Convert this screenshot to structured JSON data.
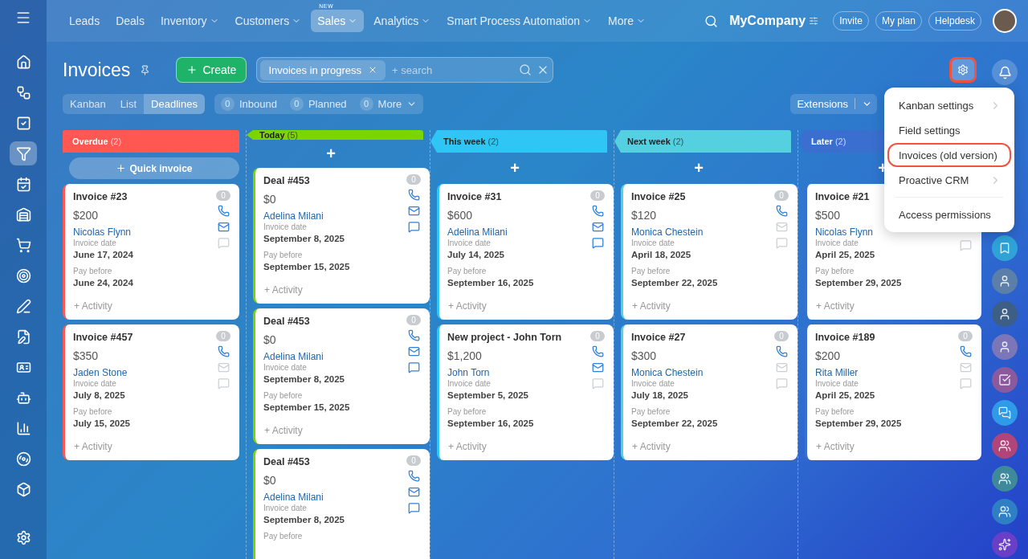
{
  "sidebar": {
    "items": [
      {
        "selected": false
      },
      {
        "selected": false
      },
      {
        "selected": false
      },
      {
        "selected": true
      },
      {
        "selected": false
      },
      {
        "selected": false
      },
      {
        "selected": false
      },
      {
        "selected": false
      },
      {
        "selected": false
      },
      {
        "selected": false
      },
      {
        "selected": false
      },
      {
        "selected": false
      },
      {
        "selected": false
      },
      {
        "selected": false
      },
      {
        "selected": false
      }
    ]
  },
  "topnav": {
    "items": [
      {
        "label": "Leads",
        "has_menu": false,
        "selected": false
      },
      {
        "label": "Deals",
        "has_menu": false,
        "selected": false
      },
      {
        "label": "Inventory",
        "has_menu": true,
        "selected": false
      },
      {
        "label": "Customers",
        "has_menu": true,
        "selected": false
      },
      {
        "label": "Sales",
        "has_menu": true,
        "selected": true,
        "badge": "NEW"
      },
      {
        "label": "Analytics",
        "has_menu": true,
        "selected": false
      },
      {
        "label": "Smart Process Automation",
        "has_menu": true,
        "selected": false
      },
      {
        "label": "More",
        "has_menu": true,
        "selected": false
      }
    ],
    "company": "MyCompany",
    "buttons": [
      "Invite",
      "My plan",
      "Helpdesk"
    ]
  },
  "header": {
    "title": "Invoices",
    "create": "Create",
    "filter_tag": "Invoices in progress",
    "search_placeholder": "+ search",
    "settings_highlighted": true
  },
  "views": [
    {
      "label": "Kanban",
      "selected": false
    },
    {
      "label": "List",
      "selected": false
    },
    {
      "label": "Deadlines",
      "selected": true
    }
  ],
  "counters": [
    {
      "count": "0",
      "label": "Inbound",
      "has_menu": false
    },
    {
      "count": "0",
      "label": "Planned",
      "has_menu": false
    },
    {
      "count": "0",
      "label": "More",
      "has_menu": true
    }
  ],
  "extensions": "Extensions",
  "menu": {
    "items": [
      {
        "kind": "item",
        "label": "Kanban settings",
        "has_submenu": true,
        "highlighted": false
      },
      {
        "kind": "item",
        "label": "Field settings",
        "has_submenu": false,
        "highlighted": false
      },
      {
        "kind": "item",
        "label": "Invoices (old version)",
        "has_submenu": false,
        "highlighted": true
      },
      {
        "kind": "item",
        "label": "Proactive CRM",
        "has_submenu": true,
        "highlighted": false
      },
      {
        "kind": "divider"
      },
      {
        "kind": "item",
        "label": "Access permissions",
        "has_submenu": false,
        "highlighted": false
      }
    ]
  },
  "columns": [
    {
      "title": "Overdue",
      "count": "(2)",
      "color": "#ff5752",
      "add": {
        "kind": "quick",
        "label": "Quick invoice"
      },
      "cards": [
        {
          "title": "Invoice #23",
          "amount": "$200",
          "contact": "Nicolas Flynn",
          "counter": "0",
          "mail_active": true,
          "chat_active": false,
          "fields": [
            {
              "label": "Invoice date",
              "value": "June 17, 2024"
            },
            {
              "label": "Pay before",
              "value": "June 24, 2024"
            }
          ],
          "activity": "+ Activity"
        },
        {
          "title": "Invoice #457",
          "amount": "$350",
          "contact": "Jaden Stone",
          "counter": "0",
          "mail_active": false,
          "chat_active": false,
          "fields": [
            {
              "label": "Invoice date",
              "value": "July 8, 2025"
            },
            {
              "label": "Pay before",
              "value": "July 15, 2025"
            }
          ],
          "activity": "+ Activity"
        }
      ]
    },
    {
      "title": "Today",
      "count": "(5)",
      "color": "#7bd500",
      "add": {
        "kind": "plus",
        "label": "+"
      },
      "cards": [
        {
          "title": "Deal #453",
          "amount": "$0",
          "contact": "Adelina Milani",
          "counter": "0",
          "mail_active": true,
          "chat_active": true,
          "fields": [
            {
              "label": "Invoice date",
              "value": "September 8, 2025"
            },
            {
              "label": "Pay before",
              "value": "September 15, 2025"
            }
          ],
          "activity": "+ Activity"
        },
        {
          "title": "Deal #453",
          "amount": "$0",
          "contact": "Adelina Milani",
          "counter": "0",
          "mail_active": true,
          "chat_active": true,
          "fields": [
            {
              "label": "Invoice date",
              "value": "September 8, 2025"
            },
            {
              "label": "Pay before",
              "value": "September 15, 2025"
            }
          ],
          "activity": "+ Activity"
        },
        {
          "title": "Deal #453",
          "amount": "$0",
          "contact": "Adelina Milani",
          "counter": "0",
          "mail_active": true,
          "chat_active": true,
          "fields": [
            {
              "label": "Invoice date",
              "value": "September 8, 2025"
            },
            {
              "label": "Pay before"
            }
          ]
        }
      ]
    },
    {
      "title": "This week",
      "count": "(2)",
      "color": "#2fc6f6",
      "add": {
        "kind": "plus",
        "label": "+"
      },
      "cards": [
        {
          "title": "Invoice #31",
          "amount": "$600",
          "contact": "Adelina Milani",
          "counter": "0",
          "mail_active": true,
          "chat_active": true,
          "fields": [
            {
              "label": "Invoice date",
              "value": "July 14, 2025"
            },
            {
              "label": "Pay before",
              "value": "September 16, 2025"
            }
          ],
          "activity": "+ Activity"
        },
        {
          "title": "New project - John Torn",
          "amount": "$1,200",
          "contact": "John Torn",
          "counter": "0",
          "mail_active": true,
          "chat_active": false,
          "fields": [
            {
              "label": "Invoice date",
              "value": "September 5, 2025"
            },
            {
              "label": "Pay before",
              "value": "September 16, 2025"
            }
          ],
          "activity": "+ Activity"
        }
      ]
    },
    {
      "title": "Next week",
      "count": "(2)",
      "color": "#55d0e0",
      "add": {
        "kind": "plus",
        "label": "+"
      },
      "cards": [
        {
          "title": "Invoice #25",
          "amount": "$120",
          "contact": "Monica Chestein",
          "counter": "0",
          "mail_active": false,
          "chat_active": false,
          "fields": [
            {
              "label": "Invoice date",
              "value": "April 18, 2025"
            },
            {
              "label": "Pay before",
              "value": "September 22, 2025"
            }
          ],
          "activity": "+ Activity"
        },
        {
          "title": "Invoice #27",
          "amount": "$300",
          "contact": "Monica Chestein",
          "counter": "0",
          "mail_active": false,
          "chat_active": false,
          "fields": [
            {
              "label": "Invoice date",
              "value": "July 18, 2025"
            },
            {
              "label": "Pay before",
              "value": "September 22, 2025"
            }
          ],
          "activity": "+ Activity"
        }
      ]
    },
    {
      "title": "Later",
      "count": "(2)",
      "color": "#3a6fd0",
      "add": {
        "kind": "plus",
        "label": "+"
      },
      "cards": [
        {
          "title": "Invoice #21",
          "amount": "$500",
          "contact": "Nicolas Flynn",
          "chat_active": false,
          "fields": [
            {
              "label": "Invoice date",
              "value": "April 25, 2025"
            },
            {
              "label": "Pay before",
              "value": "September 29, 2025"
            }
          ],
          "activity": "+ Activity"
        },
        {
          "title": "Invoice #189",
          "amount": "$200",
          "contact": "Rita Miller",
          "counter": "0",
          "mail_active": false,
          "chat_active": false,
          "fields": [
            {
              "label": "Invoice date",
              "value": "April 25, 2025"
            },
            {
              "label": "Pay before",
              "value": "September 29, 2025"
            }
          ],
          "activity": "+ Activity"
        }
      ]
    }
  ],
  "rail": {
    "items": [
      {
        "kind": "bookmark"
      },
      {
        "kind": "avatar"
      },
      {
        "kind": "avatar"
      },
      {
        "kind": "avatar"
      },
      {
        "kind": "task"
      },
      {
        "kind": "chat"
      },
      {
        "kind": "group"
      },
      {
        "kind": "group"
      },
      {
        "kind": "group"
      },
      {
        "kind": "copilot"
      }
    ]
  }
}
